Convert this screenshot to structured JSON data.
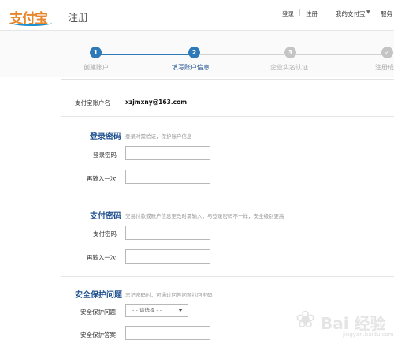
{
  "header": {
    "logo_text": "支付宝",
    "title": "注册",
    "nav": {
      "login": "登录",
      "register": "注册",
      "my_alipay": "我的支付宝",
      "extra": "服务"
    }
  },
  "steps": [
    {
      "number": "1",
      "label": "创建账户",
      "status": "done"
    },
    {
      "number": "2",
      "label": "填写账户信息",
      "status": "current"
    },
    {
      "number": "3",
      "label": "企业实名认证",
      "status": "todo"
    },
    {
      "number": "✓",
      "label": "注册成",
      "status": "todo"
    }
  ],
  "account": {
    "label": "支付宝账户名",
    "value": "xzjmxny@163.com"
  },
  "login_password": {
    "title": "登录密码",
    "desc": "登录时需验证，保护账户信息",
    "field1_label": "登录密码",
    "field2_label": "再输入一次"
  },
  "pay_password": {
    "title": "支付密码",
    "desc": "交易付款或账户信息更改时需输入，与登录密码不一样，安全级别更高",
    "field1_label": "支付密码",
    "field2_label": "再输入一次"
  },
  "security": {
    "title": "安全保护问题",
    "desc": "忘记密码时，可通过回答问题找回密码",
    "question_label": "安全保护问题",
    "question_selected": "- - 请选择 - -",
    "answer_label": "安全保护答案"
  },
  "watermark": {
    "text": "Bai 经验",
    "sub": "jingyan.baidu.com"
  },
  "colors": {
    "primary": "#2e7ab8",
    "title": "#1e4f8f",
    "todo": "#c4c4c4",
    "logo": "#e8862c"
  }
}
